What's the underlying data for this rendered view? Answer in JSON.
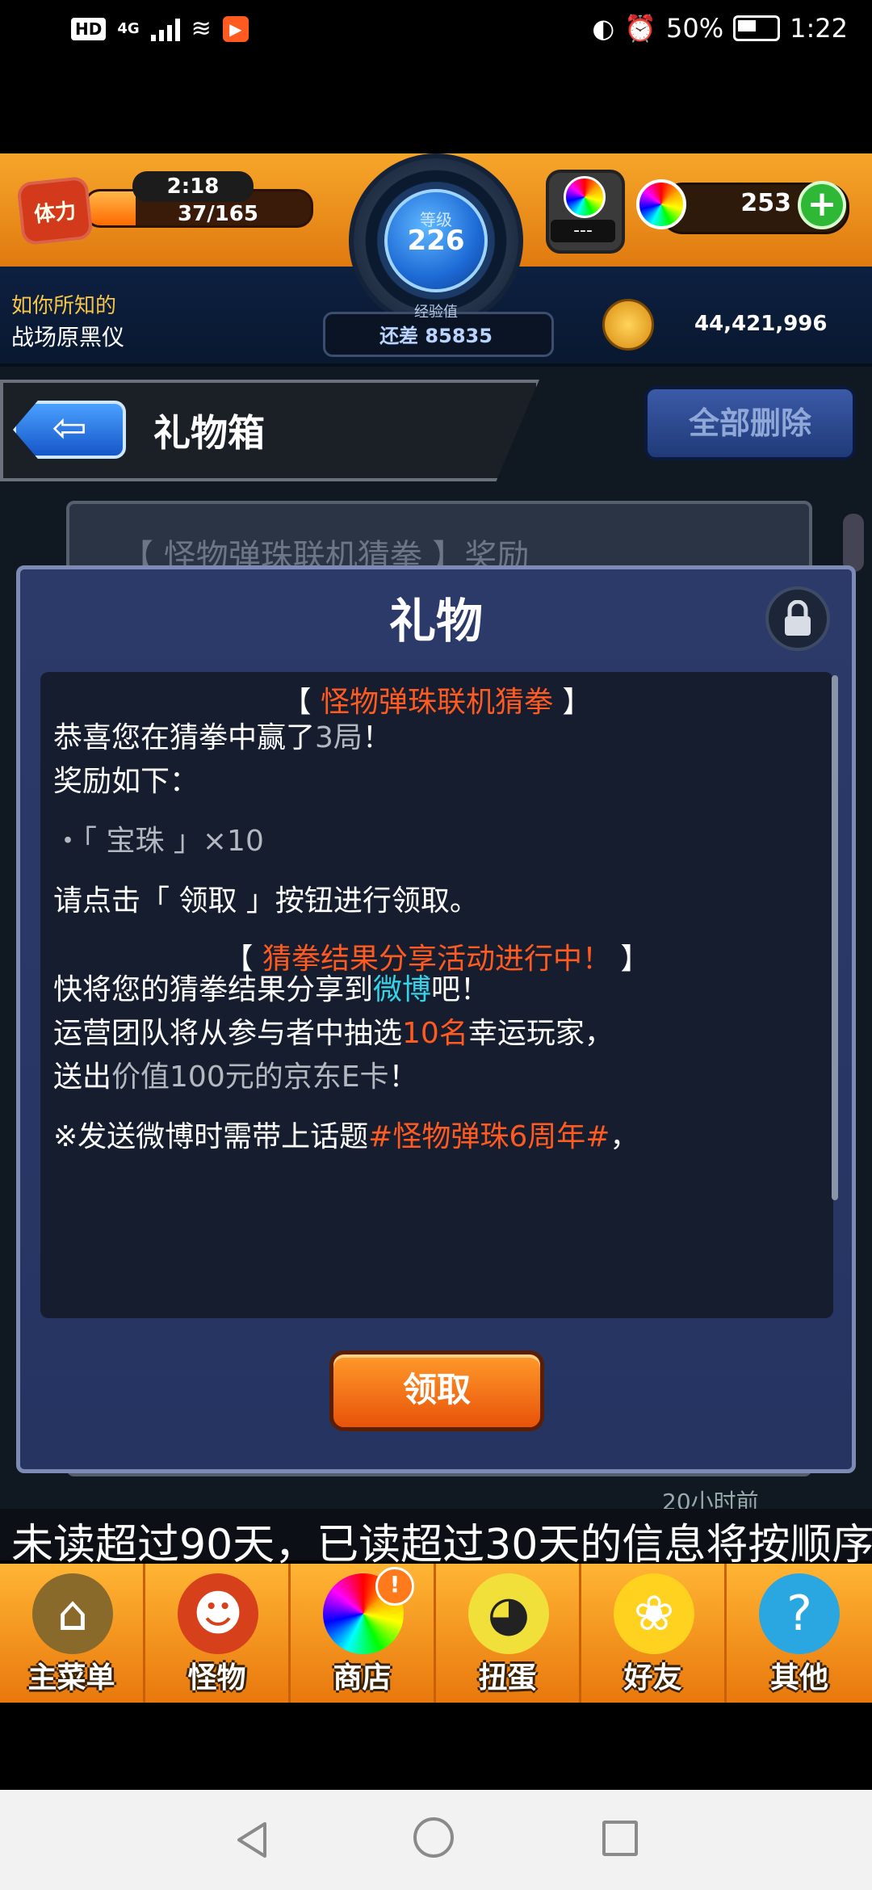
{
  "status_bar": {
    "hd": "HD",
    "network": "4G",
    "battery": "50%",
    "time": "1:22"
  },
  "header": {
    "stamina_label": "体力",
    "stamina_timer": "2:18",
    "stamina_count": "37/165",
    "stamina_fraction": 0.22,
    "level_label": "等级",
    "level": "226",
    "exp_label": "经验值",
    "exp_remaining": "还差 85835",
    "egg_counter": "---",
    "orb_count": "253",
    "plus_label": "+",
    "info_line1": "如你所知的",
    "info_line2": "战场原黑仪",
    "gold": "44,421,996"
  },
  "page": {
    "back_arrow": "⇦",
    "title": "礼物箱",
    "delete_all": "全部删除",
    "list_item_title": "【 怪物弹珠联机猜拳 】奖励",
    "time_ago": "20小时前"
  },
  "dialog": {
    "title": "礼物",
    "message": {
      "l1_a": "【 ",
      "l1_b": "怪物弹珠联机猜拳",
      "l1_c": " 】",
      "l2_a": "恭喜您在猜拳中赢了",
      "l2_b": "3局",
      "l2_c": "！",
      "l3": "奖励如下：",
      "l4": "・「 宝珠 」×10",
      "l5": "请点击「 领取 」按钮进行领取。",
      "l6_a": "【 ",
      "l6_b": "猜拳结果分享活动进行中！",
      "l6_c": " 】",
      "l7_a": "快将您的猜拳结果分享到",
      "l7_b": "微博",
      "l7_c": "吧！",
      "l8_a": "运营团队将从参与者中抽选",
      "l8_b": "10名",
      "l8_c": "幸运玩家，",
      "l9_a": "送出",
      "l9_b": "价值100元的京东E卡",
      "l9_c": "！",
      "l10_a": "※发送微博时需带上话题",
      "l10_b": "#怪物弹珠6周年#",
      "l10_c": "，"
    },
    "claim": "领取"
  },
  "ticker": "未读超过90天，已读超过30天的信息将按顺序",
  "menu": [
    {
      "label": "主菜单",
      "icon": "home-castle-icon"
    },
    {
      "label": "怪物",
      "icon": "monster-icon"
    },
    {
      "label": "商店",
      "icon": "shop-orb-icon",
      "badge": "!"
    },
    {
      "label": "扭蛋",
      "icon": "gacha-egg-icon"
    },
    {
      "label": "好友",
      "icon": "friends-icon"
    },
    {
      "label": "其他",
      "icon": "other-icon"
    }
  ],
  "colors": {
    "accent_orange": "#ff5a1f",
    "highlight_cyan": "#35d2e8",
    "header_orange": "#f6a62a",
    "dialog_blue": "#2c3a6a"
  }
}
